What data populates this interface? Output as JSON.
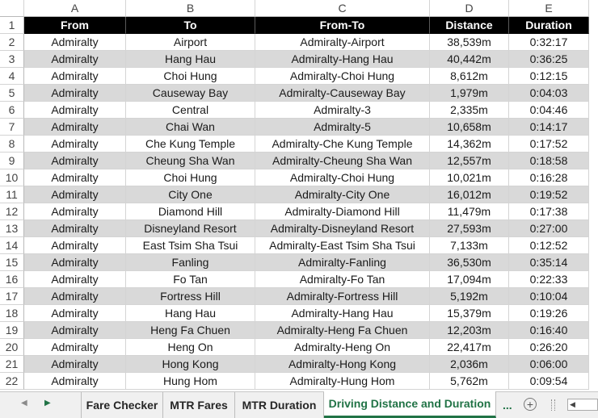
{
  "column_letters": [
    "A",
    "B",
    "C",
    "D",
    "E"
  ],
  "header_row": {
    "row_number": "1",
    "cells": [
      "From",
      "To",
      "From-To",
      "Distance",
      "Duration"
    ]
  },
  "rows": [
    {
      "n": "2",
      "from": "Admiralty",
      "to": "Airport",
      "from_to": "Admiralty-Airport",
      "distance": "38,539m",
      "duration": "0:32:17"
    },
    {
      "n": "3",
      "from": "Admiralty",
      "to": "Hang Hau",
      "from_to": "Admiralty-Hang Hau",
      "distance": "40,442m",
      "duration": "0:36:25"
    },
    {
      "n": "4",
      "from": "Admiralty",
      "to": "Choi Hung",
      "from_to": "Admiralty-Choi Hung",
      "distance": "8,612m",
      "duration": "0:12:15"
    },
    {
      "n": "5",
      "from": "Admiralty",
      "to": "Causeway Bay",
      "from_to": "Admiralty-Causeway Bay",
      "distance": "1,979m",
      "duration": "0:04:03"
    },
    {
      "n": "6",
      "from": "Admiralty",
      "to": "Central",
      "from_to": "Admiralty-3",
      "distance": "2,335m",
      "duration": "0:04:46"
    },
    {
      "n": "7",
      "from": "Admiralty",
      "to": "Chai Wan",
      "from_to": "Admiralty-5",
      "distance": "10,658m",
      "duration": "0:14:17"
    },
    {
      "n": "8",
      "from": "Admiralty",
      "to": "Che Kung Temple",
      "from_to": "Admiralty-Che Kung Temple",
      "distance": "14,362m",
      "duration": "0:17:52"
    },
    {
      "n": "9",
      "from": "Admiralty",
      "to": "Cheung Sha Wan",
      "from_to": "Admiralty-Cheung Sha Wan",
      "distance": "12,557m",
      "duration": "0:18:58"
    },
    {
      "n": "10",
      "from": "Admiralty",
      "to": "Choi Hung",
      "from_to": "Admiralty-Choi Hung",
      "distance": "10,021m",
      "duration": "0:16:28"
    },
    {
      "n": "11",
      "from": "Admiralty",
      "to": "City One",
      "from_to": "Admiralty-City One",
      "distance": "16,012m",
      "duration": "0:19:52"
    },
    {
      "n": "12",
      "from": "Admiralty",
      "to": "Diamond Hill",
      "from_to": "Admiralty-Diamond Hill",
      "distance": "11,479m",
      "duration": "0:17:38"
    },
    {
      "n": "13",
      "from": "Admiralty",
      "to": "Disneyland Resort",
      "from_to": "Admiralty-Disneyland Resort",
      "distance": "27,593m",
      "duration": "0:27:00"
    },
    {
      "n": "14",
      "from": "Admiralty",
      "to": "East Tsim Sha Tsui",
      "from_to": "Admiralty-East Tsim Sha Tsui",
      "distance": "7,133m",
      "duration": "0:12:52"
    },
    {
      "n": "15",
      "from": "Admiralty",
      "to": "Fanling",
      "from_to": "Admiralty-Fanling",
      "distance": "36,530m",
      "duration": "0:35:14"
    },
    {
      "n": "16",
      "from": "Admiralty",
      "to": "Fo Tan",
      "from_to": "Admiralty-Fo Tan",
      "distance": "17,094m",
      "duration": "0:22:33"
    },
    {
      "n": "17",
      "from": "Admiralty",
      "to": "Fortress Hill",
      "from_to": "Admiralty-Fortress Hill",
      "distance": "5,192m",
      "duration": "0:10:04"
    },
    {
      "n": "18",
      "from": "Admiralty",
      "to": "Hang Hau",
      "from_to": "Admiralty-Hang Hau",
      "distance": "15,379m",
      "duration": "0:19:26"
    },
    {
      "n": "19",
      "from": "Admiralty",
      "to": "Heng Fa Chuen",
      "from_to": "Admiralty-Heng Fa Chuen",
      "distance": "12,203m",
      "duration": "0:16:40"
    },
    {
      "n": "20",
      "from": "Admiralty",
      "to": "Heng On",
      "from_to": "Admiralty-Heng On",
      "distance": "22,417m",
      "duration": "0:26:20"
    },
    {
      "n": "21",
      "from": "Admiralty",
      "to": "Hong Kong",
      "from_to": "Admiralty-Hong Kong",
      "distance": "2,036m",
      "duration": "0:06:00"
    },
    {
      "n": "22",
      "from": "Admiralty",
      "to": "Hung Hom",
      "from_to": "Admiralty-Hung Hom",
      "distance": "5,762m",
      "duration": "0:09:54"
    }
  ],
  "sheet_tabs": [
    {
      "label": "Fare Checker",
      "active": false
    },
    {
      "label": "MTR Fares",
      "active": false
    },
    {
      "label": "MTR Duration",
      "active": false
    },
    {
      "label": "Driving Distance and Duration",
      "active": true
    }
  ],
  "tab_overflow_label": "...",
  "add_sheet_label": "+",
  "colors": {
    "header_fill": "#000000",
    "header_text": "#ffffff",
    "band_fill": "#d9d9d9",
    "active_tab_text": "#217346"
  },
  "icons": {
    "prev_sheet": "triangle-left",
    "next_sheet": "triangle-right",
    "add_sheet": "circle-plus",
    "scroll_left": "triangle-left"
  }
}
